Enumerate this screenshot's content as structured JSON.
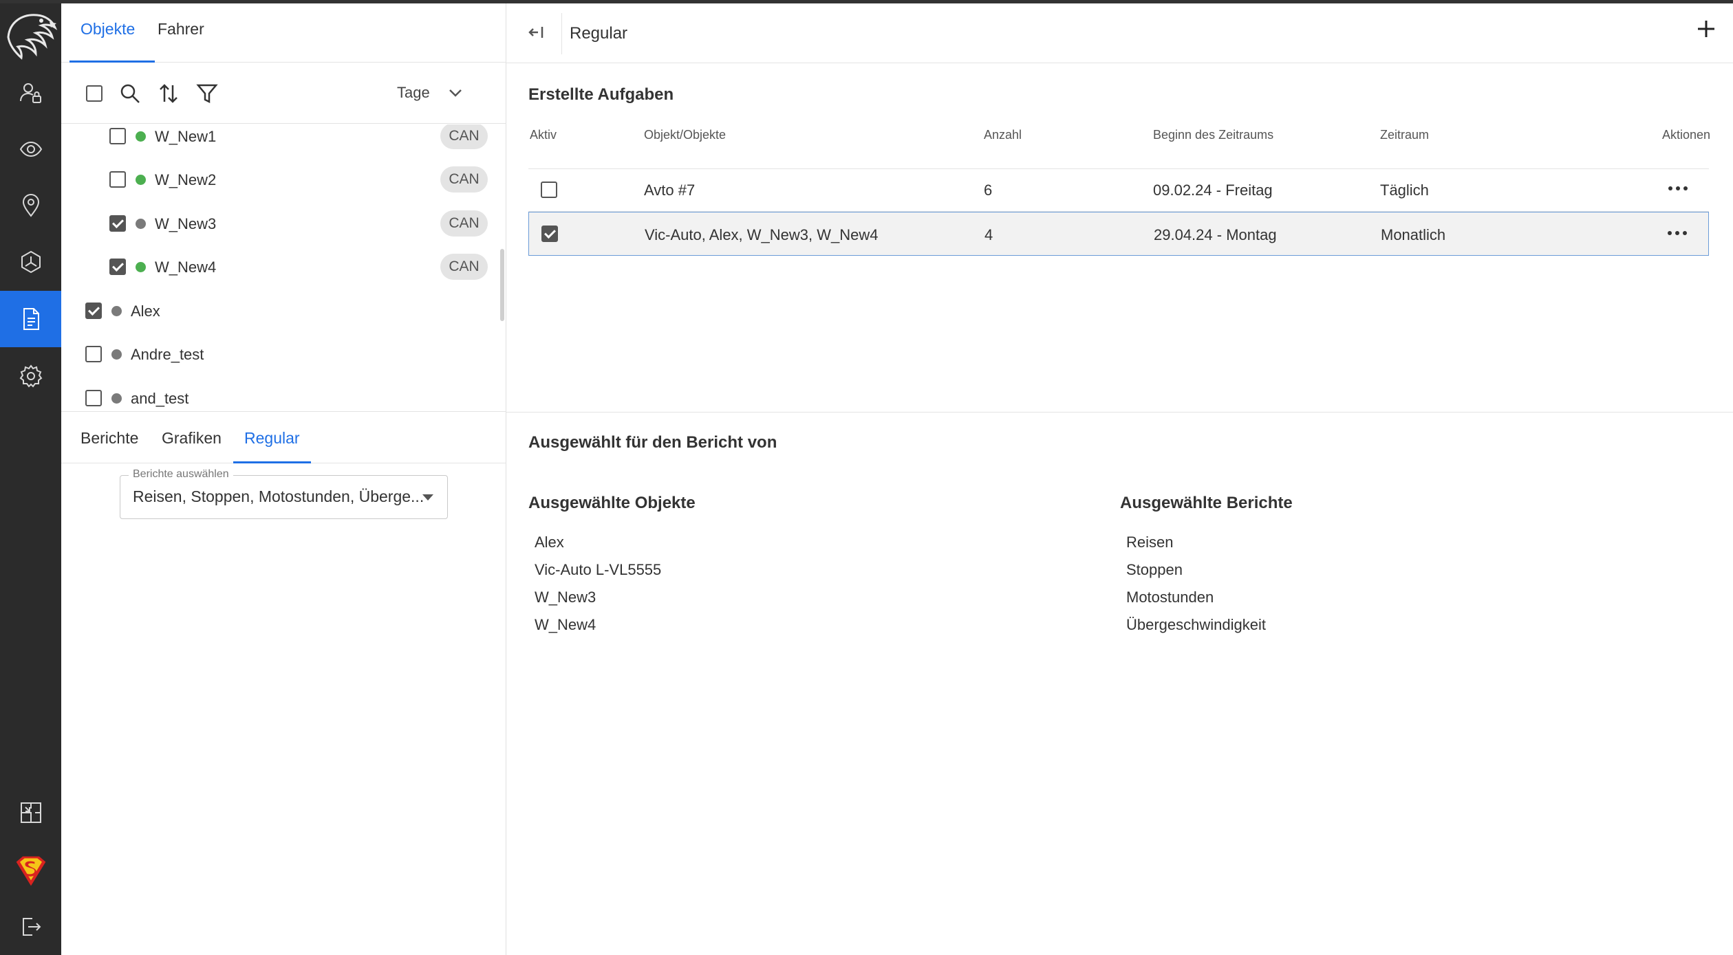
{
  "rail": {
    "items": [
      {
        "name": "users-lock-icon"
      },
      {
        "name": "eye-icon"
      },
      {
        "name": "location-pin-icon"
      },
      {
        "name": "hexagon-icon"
      },
      {
        "name": "document-icon",
        "active": true
      },
      {
        "name": "gear-icon"
      }
    ],
    "bottom": [
      {
        "name": "export-icon"
      },
      {
        "name": "superman-avatar-icon"
      },
      {
        "name": "logout-icon"
      }
    ],
    "active_color": "#1f6fe5"
  },
  "objects_panel": {
    "tabs": [
      {
        "label": "Objekte",
        "active": true
      },
      {
        "label": "Fahrer",
        "active": false
      }
    ],
    "toolbar": {
      "period_label": "Tage"
    },
    "items": [
      {
        "label": "W_New1",
        "checked": false,
        "status": "green",
        "badge": "CAN",
        "indent": true
      },
      {
        "label": "W_New2",
        "checked": false,
        "status": "green",
        "badge": "CAN",
        "indent": true
      },
      {
        "label": "W_New3",
        "checked": true,
        "status": "grey",
        "badge": "CAN",
        "indent": true
      },
      {
        "label": "W_New4",
        "checked": true,
        "status": "green",
        "badge": "CAN",
        "indent": true
      },
      {
        "label": "Alex",
        "checked": true,
        "status": "grey",
        "badge": null,
        "indent": false
      },
      {
        "label": "Andre_test",
        "checked": false,
        "status": "grey",
        "badge": null,
        "indent": false
      },
      {
        "label": "and_test",
        "checked": false,
        "status": "grey",
        "badge": null,
        "indent": false
      }
    ],
    "bottom_tabs": [
      {
        "label": "Berichte",
        "active": false
      },
      {
        "label": "Grafiken",
        "active": false
      },
      {
        "label": "Regular",
        "active": true
      }
    ],
    "report_select": {
      "legend": "Berichte auswählen",
      "value": "Reisen, Stoppen, Motostunden, Überge..."
    }
  },
  "main": {
    "header_title": "Regular",
    "tasks_title": "Erstellte Aufgaben",
    "columns": [
      "Aktiv",
      "Objekt/Objekte",
      "Anzahl",
      "Beginn des Zeitraums",
      "Zeitraum",
      "Aktionen"
    ],
    "rows": [
      {
        "active": false,
        "objects": "Avto #7",
        "count": "6",
        "start": "09.02.24 - Freitag",
        "period": "Täglich",
        "selected": false
      },
      {
        "active": true,
        "objects": "Vic-Auto, Alex, W_New3, W_New4",
        "count": "4",
        "start": "29.04.24 - Montag",
        "period": "Monatlich",
        "selected": true
      }
    ],
    "selected_title": "Ausgewählt für den Bericht von",
    "selected_objects_title": "Ausgewählte Objekte",
    "selected_objects": [
      "Alex",
      "Vic-Auto L-VL5555",
      "W_New3",
      "W_New4"
    ],
    "selected_reports_title": "Ausgewählte Berichte",
    "selected_reports": [
      "Reisen",
      "Stoppen",
      "Motostunden",
      "Übergeschwindigkeit"
    ]
  }
}
